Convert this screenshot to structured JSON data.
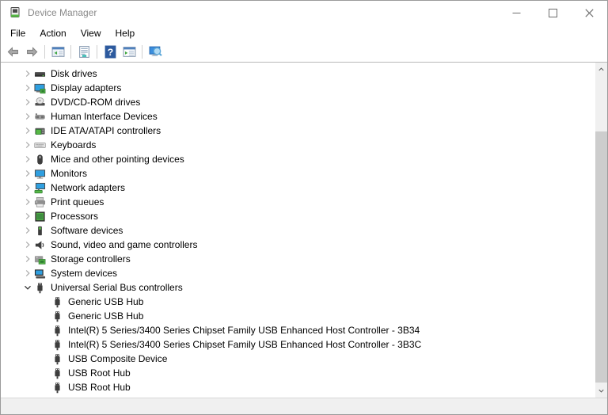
{
  "window": {
    "title": "Device Manager",
    "controls": [
      {
        "name": "minimize",
        "icon": "minimize-icon"
      },
      {
        "name": "maximize",
        "icon": "maximize-icon"
      },
      {
        "name": "close",
        "icon": "close-icon"
      }
    ]
  },
  "menu": {
    "items": [
      {
        "label": "File"
      },
      {
        "label": "Action"
      },
      {
        "label": "View"
      },
      {
        "label": "Help"
      }
    ]
  },
  "toolbar": {
    "items": [
      {
        "type": "button",
        "name": "back",
        "icon": "arrow-left"
      },
      {
        "type": "button",
        "name": "forward",
        "icon": "arrow-right"
      },
      {
        "type": "separator"
      },
      {
        "type": "button",
        "name": "show-hide-console-tree",
        "icon": "console-tree-window"
      },
      {
        "type": "separator"
      },
      {
        "type": "button",
        "name": "properties",
        "icon": "list-document"
      },
      {
        "type": "separator"
      },
      {
        "type": "button",
        "name": "help",
        "icon": "help-question"
      },
      {
        "type": "button",
        "name": "show-hide-action-pane",
        "icon": "action-pane-window"
      },
      {
        "type": "separator"
      },
      {
        "type": "button",
        "name": "scan-for-hardware-changes",
        "icon": "scan-monitor-magnifier"
      }
    ]
  },
  "tree": {
    "items": [
      {
        "label": "Disk drives",
        "icon": "disk-drive",
        "level": 0,
        "state": "collapsed"
      },
      {
        "label": "Display adapters",
        "icon": "display-adapter",
        "level": 0,
        "state": "collapsed"
      },
      {
        "label": "DVD/CD-ROM drives",
        "icon": "dvd-drive",
        "level": 0,
        "state": "collapsed"
      },
      {
        "label": "Human Interface Devices",
        "icon": "hid-gamepad",
        "level": 0,
        "state": "collapsed"
      },
      {
        "label": "IDE ATA/ATAPI controllers",
        "icon": "ide-controller",
        "level": 0,
        "state": "collapsed"
      },
      {
        "label": "Keyboards",
        "icon": "keyboard",
        "level": 0,
        "state": "collapsed"
      },
      {
        "label": "Mice and other pointing devices",
        "icon": "mouse",
        "level": 0,
        "state": "collapsed"
      },
      {
        "label": "Monitors",
        "icon": "monitor",
        "level": 0,
        "state": "collapsed"
      },
      {
        "label": "Network adapters",
        "icon": "network-adapter",
        "level": 0,
        "state": "collapsed"
      },
      {
        "label": "Print queues",
        "icon": "printer",
        "level": 0,
        "state": "collapsed"
      },
      {
        "label": "Processors",
        "icon": "processor-chip",
        "level": 0,
        "state": "collapsed"
      },
      {
        "label": "Software devices",
        "icon": "software-device",
        "level": 0,
        "state": "collapsed"
      },
      {
        "label": "Sound, video and game controllers",
        "icon": "speaker",
        "level": 0,
        "state": "collapsed"
      },
      {
        "label": "Storage controllers",
        "icon": "storage-controller",
        "level": 0,
        "state": "collapsed"
      },
      {
        "label": "System devices",
        "icon": "system-computer",
        "level": 0,
        "state": "collapsed"
      },
      {
        "label": "Universal Serial Bus controllers",
        "icon": "usb-connector",
        "level": 0,
        "state": "expanded"
      },
      {
        "label": "Generic USB Hub",
        "icon": "usb-connector",
        "level": 1
      },
      {
        "label": "Generic USB Hub",
        "icon": "usb-connector",
        "level": 1
      },
      {
        "label": "Intel(R) 5 Series/3400 Series Chipset Family USB Enhanced Host Controller - 3B34",
        "icon": "usb-connector",
        "level": 1
      },
      {
        "label": "Intel(R) 5 Series/3400 Series Chipset Family USB Enhanced Host Controller - 3B3C",
        "icon": "usb-connector",
        "level": 1
      },
      {
        "label": "USB Composite Device",
        "icon": "usb-connector",
        "level": 1
      },
      {
        "label": "USB Root Hub",
        "icon": "usb-connector",
        "level": 1
      },
      {
        "label": "USB Root Hub",
        "icon": "usb-connector",
        "level": 1
      }
    ]
  },
  "statusbar": {
    "text": ""
  },
  "colors": {
    "title_text": "#8a8a8a",
    "help_blue": "#2d5a9e",
    "device_green": "#57b846",
    "screen_blue": "#2f9fe0",
    "scrollbar_thumb": "#cdcdcd",
    "statusbar_bg": "#f0f0f0"
  }
}
